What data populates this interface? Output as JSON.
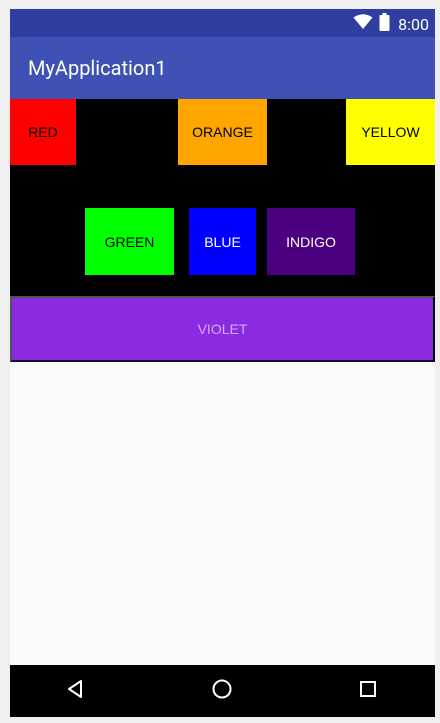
{
  "status_bar": {
    "time": "8:00",
    "icons": [
      "wifi-icon",
      "battery-icon"
    ],
    "background": "#303f9f"
  },
  "app_bar": {
    "title": "MyApplication1",
    "background": "#3f51b5"
  },
  "buttons": {
    "red": {
      "label": "RED",
      "color": "#ff0000"
    },
    "orange": {
      "label": "ORANGE",
      "color": "#ffa500"
    },
    "yellow": {
      "label": "YELLOW",
      "color": "#ffff00"
    },
    "green": {
      "label": "GREEN",
      "color": "#00ff00"
    },
    "blue": {
      "label": "BLUE",
      "color": "#0000ff"
    },
    "indigo": {
      "label": "INDIGO",
      "color": "#4b0082"
    },
    "violet": {
      "label": "VIOLET",
      "color": "#8a2be2"
    }
  },
  "nav_bar": {
    "icons": [
      "back-icon",
      "home-icon",
      "recents-icon"
    ]
  }
}
